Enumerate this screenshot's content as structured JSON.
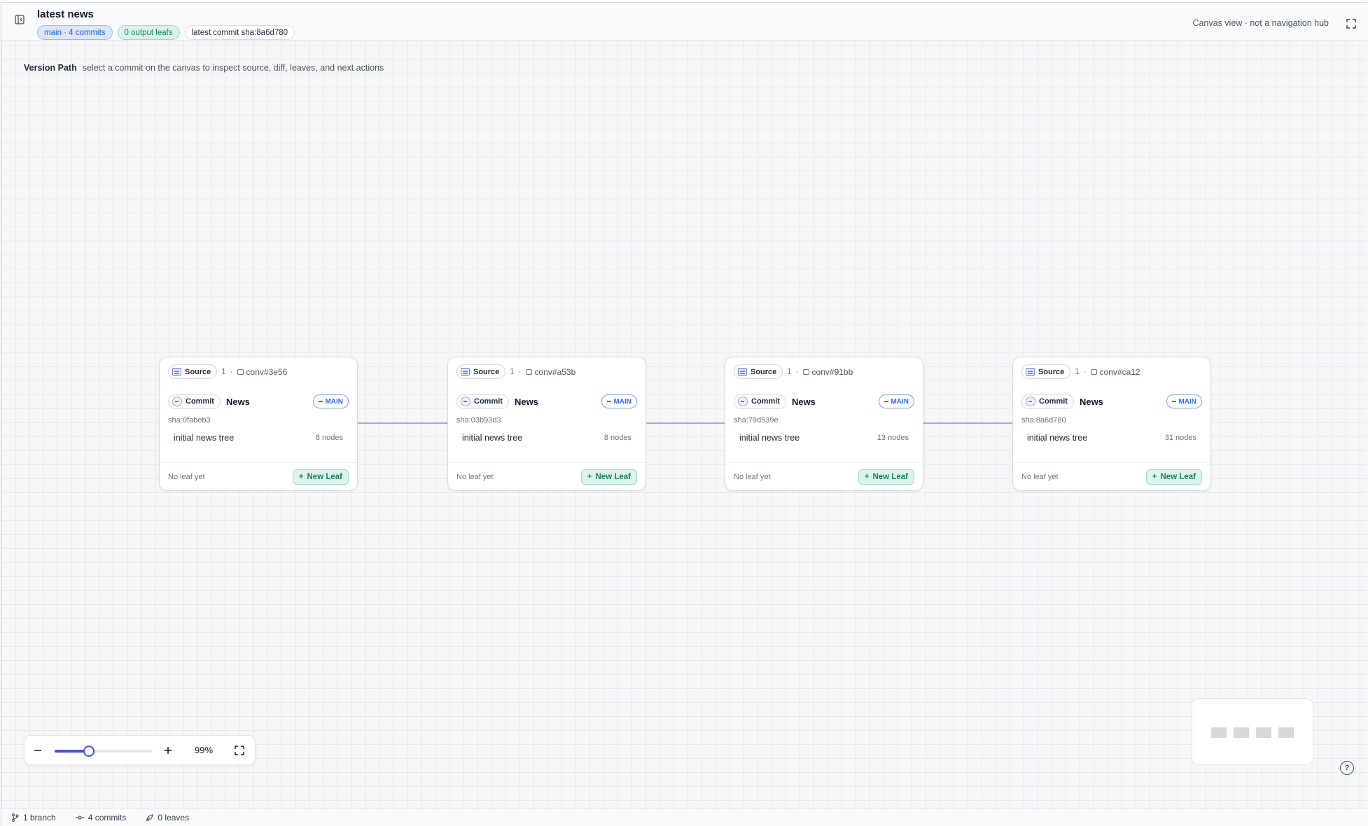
{
  "header": {
    "title": "latest news",
    "chips": {
      "branch": "main · 4 commits",
      "leafs": "0 output leafs",
      "latest": "latest commit sha:8a6d780"
    },
    "canvas_note": "Canvas view · not a navigation hub"
  },
  "version_path": {
    "label": "Version Path",
    "hint": "select a commit on the canvas to inspect source, diff, leaves, and next actions"
  },
  "commits": [
    {
      "source_label": "Source",
      "source_count": "1",
      "conv": "conv#3e56",
      "commit_label": "Commit",
      "name": "News",
      "branch_badge": "MAIN",
      "sha": "sha:0fabeb3",
      "message": "initial news tree",
      "nodes": "8 nodes",
      "leaf_status": "No leaf yet",
      "new_leaf_label": "New Leaf"
    },
    {
      "source_label": "Source",
      "source_count": "1",
      "conv": "conv#a53b",
      "commit_label": "Commit",
      "name": "News",
      "branch_badge": "MAIN",
      "sha": "sha:03b93d3",
      "message": "initial news tree",
      "nodes": "8 nodes",
      "leaf_status": "No leaf yet",
      "new_leaf_label": "New Leaf"
    },
    {
      "source_label": "Source",
      "source_count": "1",
      "conv": "conv#91bb",
      "commit_label": "Commit",
      "name": "News",
      "branch_badge": "MAIN",
      "sha": "sha:79d539e",
      "message": "initial news tree",
      "nodes": "13 nodes",
      "leaf_status": "No leaf yet",
      "new_leaf_label": "New Leaf"
    },
    {
      "source_label": "Source",
      "source_count": "1",
      "conv": "conv#ca12",
      "commit_label": "Commit",
      "name": "News",
      "branch_badge": "MAIN",
      "sha": "sha:8a6d780",
      "message": "initial news tree",
      "nodes": "31 nodes",
      "leaf_status": "No leaf yet",
      "new_leaf_label": "New Leaf"
    }
  ],
  "zoom": {
    "level_label": "99%",
    "slider_fraction": 0.35
  },
  "status_bar": {
    "branches": "1 branch",
    "commits": "4 commits",
    "leaves": "0 leaves"
  },
  "icons": {
    "sidebar_toggle": "sidebar-toggle-icon",
    "fullscreen": "fullscreen-icon",
    "help": "help-icon"
  },
  "colors": {
    "accent_blue": "#3b68d4",
    "connector": "#8fb1ea",
    "leaf_teal": "#1f8068",
    "slider": "#4a4fe0"
  }
}
